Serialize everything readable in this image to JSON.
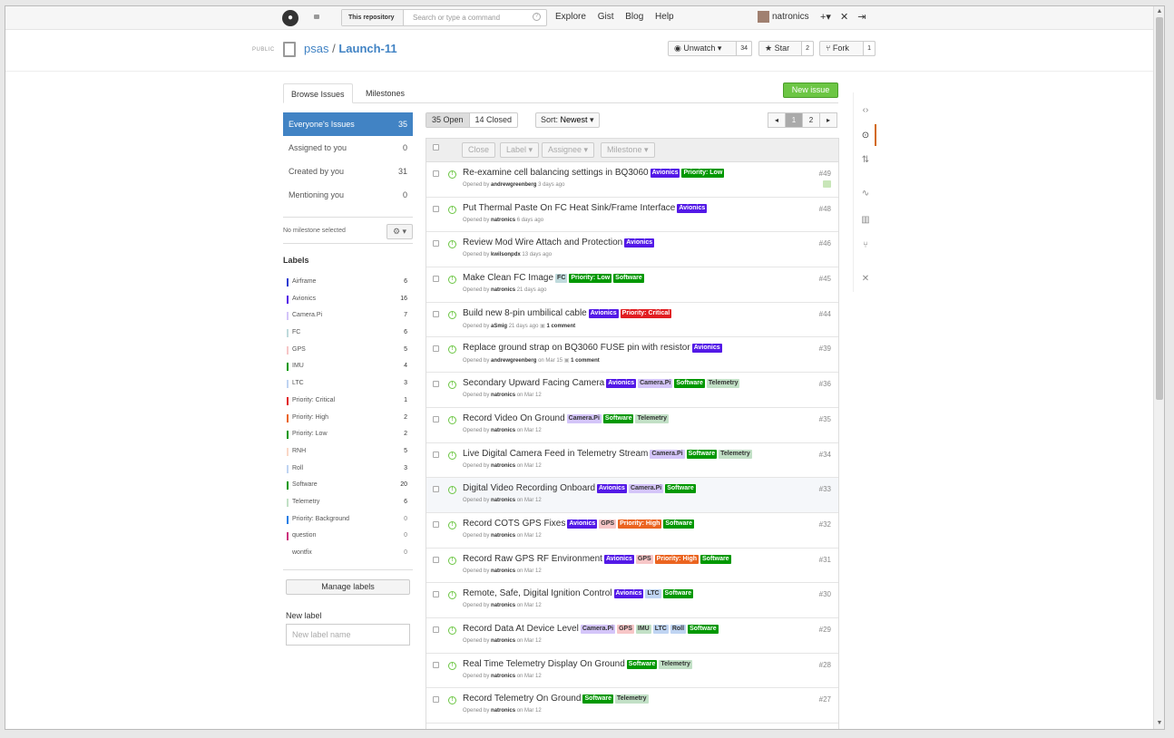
{
  "topbar": {
    "search_scope": "This repository",
    "search_placeholder": "Search or type a command",
    "nav": [
      "Explore",
      "Gist",
      "Blog",
      "Help"
    ],
    "username": "natronics"
  },
  "repo": {
    "visibility": "PUBLIC",
    "owner": "psas",
    "name": "Launch-11",
    "watch_label": "Unwatch",
    "watch_count": "34",
    "star_label": "Star",
    "star_count": "2",
    "fork_label": "Fork",
    "fork_count": "1"
  },
  "tabs": [
    "Browse Issues",
    "Milestones"
  ],
  "new_issue_label": "New issue",
  "filters": [
    {
      "label": "Everyone's Issues",
      "count": "35"
    },
    {
      "label": "Assigned to you",
      "count": "0"
    },
    {
      "label": "Created by you",
      "count": "31"
    },
    {
      "label": "Mentioning you",
      "count": "0"
    }
  ],
  "milestone_text": "No milestone selected",
  "labels_heading": "Labels",
  "labels": [
    {
      "name": "Airframe",
      "count": "6",
      "color": "#2b3bd1"
    },
    {
      "name": "Avionics",
      "count": "16",
      "color": "#5319e7"
    },
    {
      "name": "Camera.Pi",
      "count": "7",
      "color": "#d4c5f9"
    },
    {
      "name": "FC",
      "count": "6",
      "color": "#bfdadc"
    },
    {
      "name": "GPS",
      "count": "5",
      "color": "#f7c6c7"
    },
    {
      "name": "IMU",
      "count": "4",
      "color": "#009800"
    },
    {
      "name": "LTC",
      "count": "3",
      "color": "#bfd4f2"
    },
    {
      "name": "Priority: Critical",
      "count": "1",
      "color": "#e11d21"
    },
    {
      "name": "Priority: High",
      "count": "2",
      "color": "#eb6420"
    },
    {
      "name": "Priority: Low",
      "count": "2",
      "color": "#009800"
    },
    {
      "name": "RNH",
      "count": "5",
      "color": "#fad8c7"
    },
    {
      "name": "Roll",
      "count": "3",
      "color": "#bfd4f2"
    },
    {
      "name": "Software",
      "count": "20",
      "color": "#009800"
    },
    {
      "name": "Telemetry",
      "count": "6",
      "color": "#c2e0c6"
    },
    {
      "name": "Priority: Background",
      "count": "0",
      "color": "#207de5"
    },
    {
      "name": "question",
      "count": "0",
      "color": "#cc317c"
    },
    {
      "name": "wontfix",
      "count": "0",
      "color": "#ffffff"
    }
  ],
  "manage_labels": "Manage labels",
  "new_label_heading": "New label",
  "new_label_placeholder": "New label name",
  "state": {
    "open": "35 Open",
    "closed": "14 Closed"
  },
  "sort": {
    "label": "Sort:",
    "value": "Newest"
  },
  "pagination": [
    "1",
    "2"
  ],
  "bulk_actions": [
    "Close",
    "Label",
    "Assignee",
    "Milestone"
  ],
  "issues": [
    {
      "title": "Re-examine cell balancing settings in BQ3060",
      "tags": [
        {
          "t": "Avionics",
          "bg": "#5319e7",
          "fg": "#fff"
        },
        {
          "t": "Priority: Low",
          "bg": "#009800",
          "fg": "#fff"
        }
      ],
      "prefix": "Opened by",
      "author": "andrewgreenberg",
      "when": "3 days ago",
      "comments": "",
      "num": "#49"
    },
    {
      "title": "Put Thermal Paste On FC Heat Sink/Frame Interface",
      "tags": [
        {
          "t": "Avionics",
          "bg": "#5319e7",
          "fg": "#fff"
        }
      ],
      "prefix": "Opened by",
      "author": "natronics",
      "when": "6 days ago",
      "comments": "",
      "num": "#48"
    },
    {
      "title": "Review Mod Wire Attach and Protection",
      "tags": [
        {
          "t": "Avionics",
          "bg": "#5319e7",
          "fg": "#fff"
        }
      ],
      "prefix": "Opened by",
      "author": "kwilsonpdx",
      "when": "13 days ago",
      "comments": "",
      "num": "#46"
    },
    {
      "title": "Make Clean FC Image",
      "tags": [
        {
          "t": "FC",
          "bg": "#bfdadc",
          "fg": "#333"
        },
        {
          "t": "Priority: Low",
          "bg": "#009800",
          "fg": "#fff"
        },
        {
          "t": "Software",
          "bg": "#009800",
          "fg": "#fff"
        }
      ],
      "prefix": "Opened by",
      "author": "natronics",
      "when": "21 days ago",
      "comments": "",
      "num": "#45"
    },
    {
      "title": "Build new 8-pin umbilical cable",
      "tags": [
        {
          "t": "Avionics",
          "bg": "#5319e7",
          "fg": "#fff"
        },
        {
          "t": "Priority: Critical",
          "bg": "#e11d21",
          "fg": "#fff"
        }
      ],
      "prefix": "Opened by",
      "author": "aSmig",
      "when": "21 days ago",
      "comments": "1 comment",
      "num": "#44"
    },
    {
      "title": "Replace ground strap on BQ3060 FUSE pin with resistor",
      "tags": [
        {
          "t": "Avionics",
          "bg": "#5319e7",
          "fg": "#fff"
        }
      ],
      "prefix": "Opened by",
      "author": "andrewgreenberg",
      "when": "on Mar 15",
      "comments": "1 comment",
      "num": "#39"
    },
    {
      "title": "Secondary Upward Facing Camera",
      "tags": [
        {
          "t": "Avionics",
          "bg": "#5319e7",
          "fg": "#fff"
        },
        {
          "t": "Camera.Pi",
          "bg": "#d4c5f9",
          "fg": "#333"
        },
        {
          "t": "Software",
          "bg": "#009800",
          "fg": "#fff"
        },
        {
          "t": "Telemetry",
          "bg": "#c2e0c6",
          "fg": "#333"
        }
      ],
      "prefix": "Opened by",
      "author": "natronics",
      "when": "on Mar 12",
      "comments": "",
      "num": "#36"
    },
    {
      "title": "Record Video On Ground",
      "tags": [
        {
          "t": "Camera.Pi",
          "bg": "#d4c5f9",
          "fg": "#333"
        },
        {
          "t": "Software",
          "bg": "#009800",
          "fg": "#fff"
        },
        {
          "t": "Telemetry",
          "bg": "#c2e0c6",
          "fg": "#333"
        }
      ],
      "prefix": "Opened by",
      "author": "natronics",
      "when": "on Mar 12",
      "comments": "",
      "num": "#35"
    },
    {
      "title": "Live Digital Camera Feed in Telemetry Stream",
      "tags": [
        {
          "t": "Camera.Pi",
          "bg": "#d4c5f9",
          "fg": "#333"
        },
        {
          "t": "Software",
          "bg": "#009800",
          "fg": "#fff"
        },
        {
          "t": "Telemetry",
          "bg": "#c2e0c6",
          "fg": "#333"
        }
      ],
      "prefix": "Opened by",
      "author": "natronics",
      "when": "on Mar 12",
      "comments": "",
      "num": "#34"
    },
    {
      "title": "Digital Video Recording Onboard",
      "tags": [
        {
          "t": "Avionics",
          "bg": "#5319e7",
          "fg": "#fff"
        },
        {
          "t": "Camera.Pi",
          "bg": "#d4c5f9",
          "fg": "#333"
        },
        {
          "t": "Software",
          "bg": "#009800",
          "fg": "#fff"
        }
      ],
      "prefix": "Opened by",
      "author": "natronics",
      "when": "on Mar 12",
      "comments": "",
      "num": "#33"
    },
    {
      "title": "Record COTS GPS Fixes",
      "tags": [
        {
          "t": "Avionics",
          "bg": "#5319e7",
          "fg": "#fff"
        },
        {
          "t": "GPS",
          "bg": "#f7c6c7",
          "fg": "#333"
        },
        {
          "t": "Priority: High",
          "bg": "#eb6420",
          "fg": "#fff"
        },
        {
          "t": "Software",
          "bg": "#009800",
          "fg": "#fff"
        }
      ],
      "prefix": "Opened by",
      "author": "natronics",
      "when": "on Mar 12",
      "comments": "",
      "num": "#32"
    },
    {
      "title": "Record Raw GPS RF Environment",
      "tags": [
        {
          "t": "Avionics",
          "bg": "#5319e7",
          "fg": "#fff"
        },
        {
          "t": "GPS",
          "bg": "#f7c6c7",
          "fg": "#333"
        },
        {
          "t": "Priority: High",
          "bg": "#eb6420",
          "fg": "#fff"
        },
        {
          "t": "Software",
          "bg": "#009800",
          "fg": "#fff"
        }
      ],
      "prefix": "Opened by",
      "author": "natronics",
      "when": "on Mar 12",
      "comments": "",
      "num": "#31"
    },
    {
      "title": "Remote, Safe, Digital Ignition Control",
      "tags": [
        {
          "t": "Avionics",
          "bg": "#5319e7",
          "fg": "#fff"
        },
        {
          "t": "LTC",
          "bg": "#bfd4f2",
          "fg": "#333"
        },
        {
          "t": "Software",
          "bg": "#009800",
          "fg": "#fff"
        }
      ],
      "prefix": "Opened by",
      "author": "natronics",
      "when": "on Mar 12",
      "comments": "",
      "num": "#30"
    },
    {
      "title": "Record Data At Device Level",
      "tags": [
        {
          "t": "Camera.Pi",
          "bg": "#d4c5f9",
          "fg": "#333"
        },
        {
          "t": "GPS",
          "bg": "#f7c6c7",
          "fg": "#333"
        },
        {
          "t": "IMU",
          "bg": "#c2e0c6",
          "fg": "#333"
        },
        {
          "t": "LTC",
          "bg": "#bfd4f2",
          "fg": "#333"
        },
        {
          "t": "Roll",
          "bg": "#bfd4f2",
          "fg": "#333"
        },
        {
          "t": "Software",
          "bg": "#009800",
          "fg": "#fff"
        }
      ],
      "prefix": "Opened by",
      "author": "natronics",
      "when": "on Mar 12",
      "comments": "",
      "num": "#29"
    },
    {
      "title": "Real Time Telemetry Display On Ground",
      "tags": [
        {
          "t": "Software",
          "bg": "#009800",
          "fg": "#fff"
        },
        {
          "t": "Telemetry",
          "bg": "#c2e0c6",
          "fg": "#333"
        }
      ],
      "prefix": "Opened by",
      "author": "natronics",
      "when": "on Mar 12",
      "comments": "",
      "num": "#28"
    },
    {
      "title": "Record Telemetry On Ground",
      "tags": [
        {
          "t": "Software",
          "bg": "#009800",
          "fg": "#fff"
        },
        {
          "t": "Telemetry",
          "bg": "#c2e0c6",
          "fg": "#333"
        }
      ],
      "prefix": "Opened by",
      "author": "natronics",
      "when": "on Mar 12",
      "comments": "",
      "num": "#27"
    }
  ]
}
